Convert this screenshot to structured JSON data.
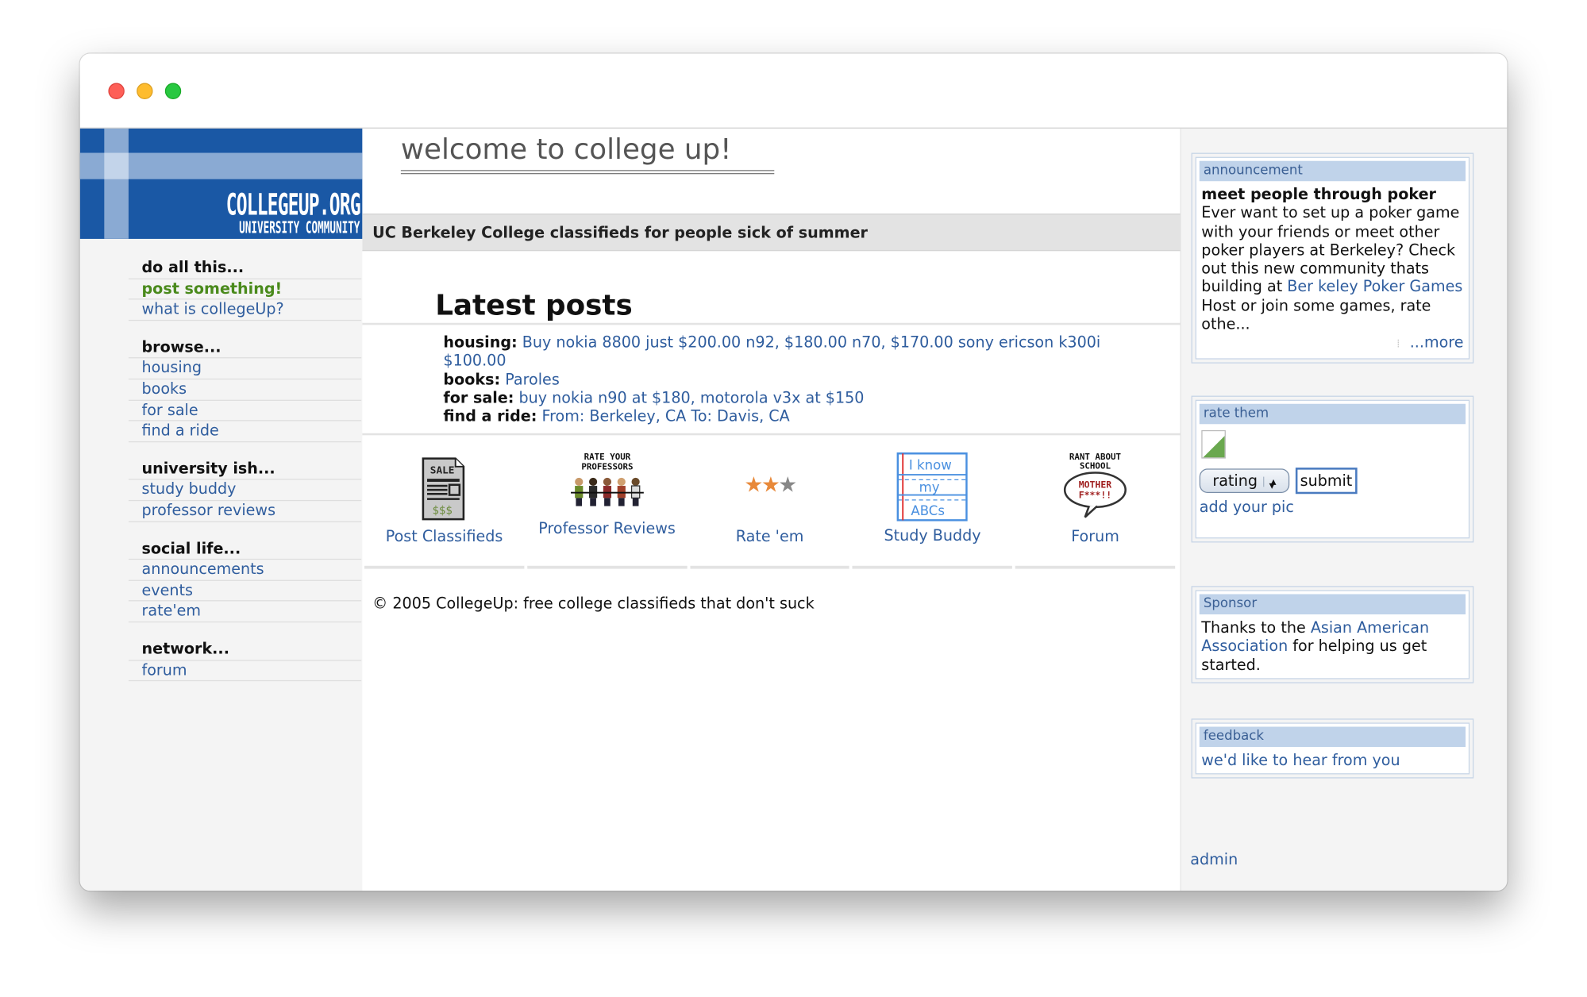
{
  "site": {
    "logo_title": "COLLEGEUP.ORG",
    "logo_subtitle": "UNIVERSITY COMMUNITY"
  },
  "nav": {
    "groups": [
      {
        "heading": "do all this...",
        "items": [
          "post something!",
          "what is collegeUp?"
        ]
      },
      {
        "heading": "browse...",
        "items": [
          "housing",
          "books",
          "for sale",
          "find a ride"
        ]
      },
      {
        "heading": "university ish...",
        "items": [
          "study buddy",
          "professor reviews"
        ]
      },
      {
        "heading": "social life...",
        "items": [
          "announcements",
          "events",
          "rate'em"
        ]
      },
      {
        "heading": "network...",
        "items": [
          "forum"
        ]
      }
    ]
  },
  "main": {
    "welcome": "welcome to college up!",
    "tagline": "UC Berkeley College classifieds for people sick of summer",
    "latest_title": "Latest posts",
    "posts": [
      {
        "label": "housing:",
        "text": "Buy nokia 8800 just $200.00 n92, $180.00 n70, $170.00 sony ericson k300i $100.00"
      },
      {
        "label": "books:",
        "text": "Paroles"
      },
      {
        "label": "for sale:",
        "text": "buy nokia n90 at $180, motorola v3x at $150"
      },
      {
        "label": "find a ride:",
        "text": "From: Berkeley, CA To: Davis, CA"
      }
    ],
    "features": [
      {
        "label": "Post Classifieds",
        "icon": "sale-sign-icon",
        "art": [
          "SALE",
          "$$$"
        ]
      },
      {
        "label": "Professor Reviews",
        "icon": "rate-professors-icon",
        "art": [
          "RATE YOUR",
          "PROFESSORS"
        ]
      },
      {
        "label": "Rate 'em",
        "icon": "stars-icon",
        "stars_filled": 2,
        "stars_total": 3
      },
      {
        "label": "Study Buddy",
        "icon": "notebook-icon",
        "art": [
          "I know",
          "my",
          "ABCs"
        ]
      },
      {
        "label": "Forum",
        "icon": "speech-bubble-icon",
        "art": [
          "RANT ABOUT",
          "SCHOOL",
          "MOTHER",
          "F***!!"
        ]
      }
    ],
    "copyright": "© 2005 CollegeUp: free college classifieds that don't suck"
  },
  "sidebar": {
    "announcement": {
      "header": "announcement",
      "title": "meet people through poker",
      "text_before": "Ever want to set up a poker game with your friends or meet other poker players at Berkeley? Check out this new community thats building at ",
      "link": "Ber keley Poker Games",
      "text_after": " Host or join some games, rate othe...",
      "more": "...more"
    },
    "rate": {
      "header": "rate them",
      "select_value": "rating",
      "submit": "submit",
      "add_pic": "add your pic"
    },
    "sponsor": {
      "header": "Sponsor",
      "text_before": "Thanks to the ",
      "link": "Asian American Association",
      "text_after": " for helping us get started."
    },
    "feedback": {
      "header": "feedback",
      "link": "we'd like to hear from you"
    },
    "admin": "admin"
  },
  "colors": {
    "link": "#2f5d9e",
    "brand_blue": "#1a58a5",
    "highlight_green": "#4a8a1c",
    "box_header": "#c0d3ea"
  }
}
